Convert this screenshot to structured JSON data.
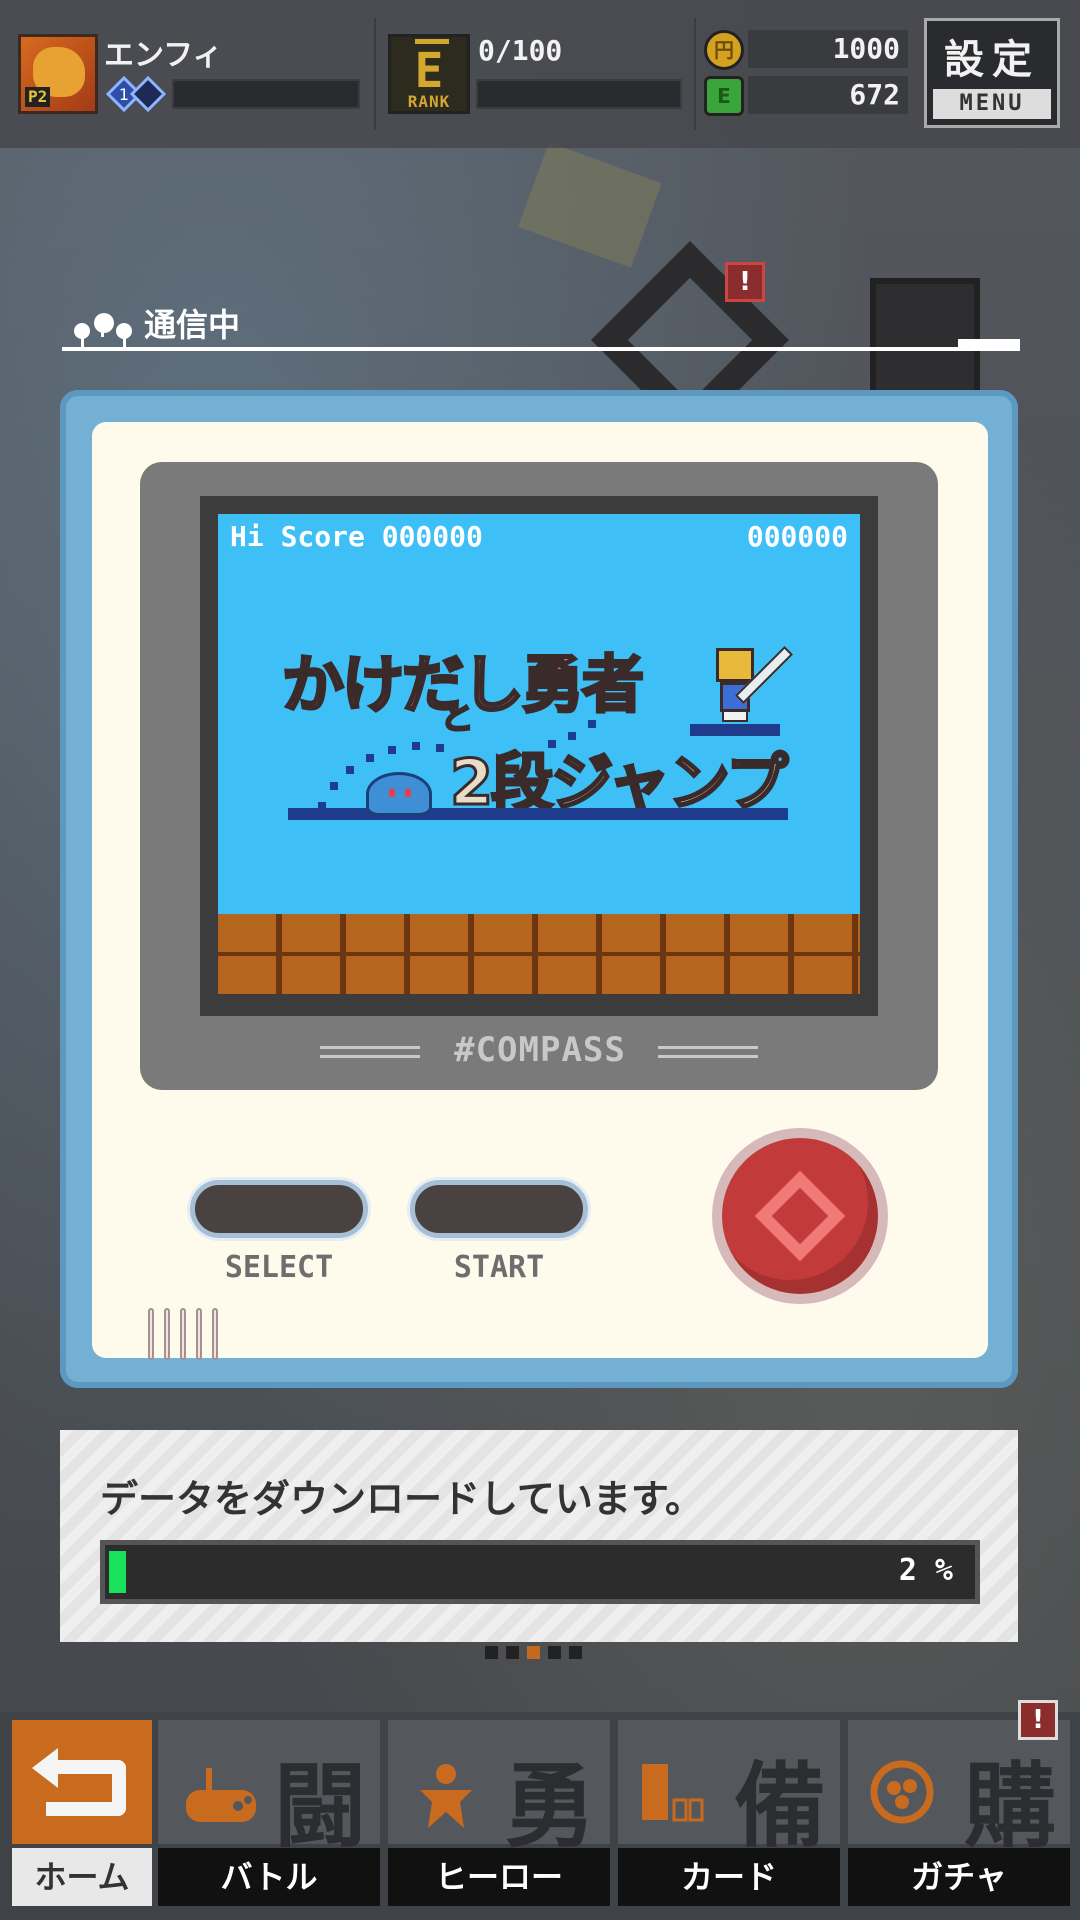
{
  "header": {
    "player_name": "エンフィ",
    "player_avatar_tag": "P2",
    "rank_letter": "E",
    "rank_label": "RANK",
    "rank_progress": "0/100",
    "gold": "1000",
    "green": "672",
    "gold_icon_glyph": "円",
    "green_icon_glyph": "E",
    "menu_kanji": "設定",
    "menu_label": "MENU"
  },
  "connecting": {
    "text": "通信中"
  },
  "console": {
    "hi_score": "Hi Score 000000",
    "score": "000000",
    "title_line1": "かけだし勇者",
    "title_to": "と",
    "title_line2": "2段ジャンプ",
    "brand": "#COMPASS",
    "select_label": "SELECT",
    "start_label": "START"
  },
  "download": {
    "message": "データをダウンロードしています。",
    "progress_percent": 2,
    "progress_label": "2 %"
  },
  "bottom_nav": {
    "items": [
      {
        "label": "ホーム",
        "kanji": ""
      },
      {
        "label": "バトル",
        "kanji": "闘"
      },
      {
        "label": "ヒーロー",
        "kanji": "勇"
      },
      {
        "label": "カード",
        "kanji": "備"
      },
      {
        "label": "ガチャ",
        "kanji": "購"
      }
    ],
    "badge": "!"
  },
  "background": {
    "badge": "!"
  },
  "colors": {
    "accent_orange": "#c96b1e",
    "progress_green": "#18e25c",
    "console_blue": "#74afd4",
    "screen_blue": "#3ec0f6"
  }
}
